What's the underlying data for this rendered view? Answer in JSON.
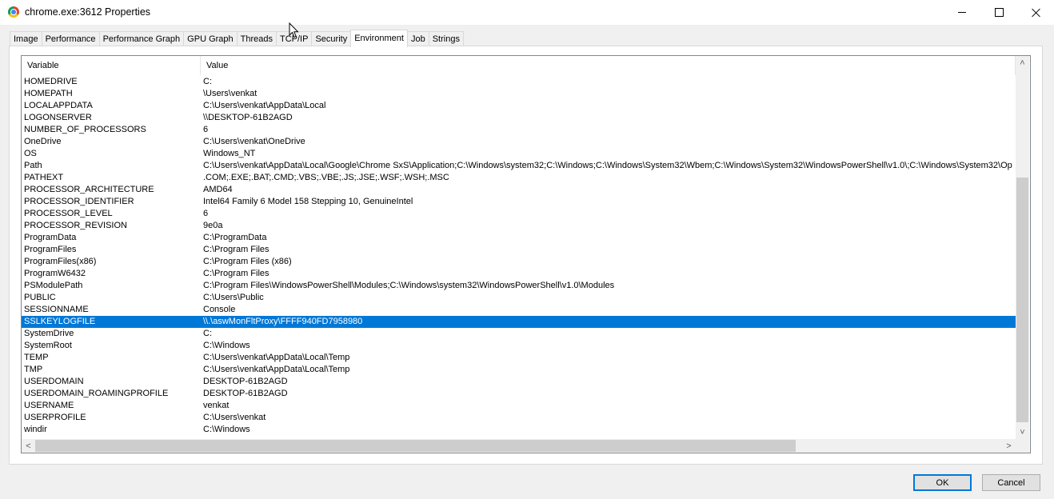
{
  "window": {
    "title": "chrome.exe:3612 Properties",
    "app_icon": "chrome-icon"
  },
  "tabs": [
    "Image",
    "Performance",
    "Performance Graph",
    "GPU Graph",
    "Threads",
    "TCP/IP",
    "Security",
    "Environment",
    "Job",
    "Strings"
  ],
  "active_tab": "Environment",
  "list": {
    "columns": [
      "Variable",
      "Value"
    ],
    "selected_row": "SSLKEYLOGFILE",
    "rows": [
      {
        "variable": "HOMEDRIVE",
        "value": "C:"
      },
      {
        "variable": "HOMEPATH",
        "value": "\\Users\\venkat"
      },
      {
        "variable": "LOCALAPPDATA",
        "value": "C:\\Users\\venkat\\AppData\\Local"
      },
      {
        "variable": "LOGONSERVER",
        "value": "\\\\DESKTOP-61B2AGD"
      },
      {
        "variable": "NUMBER_OF_PROCESSORS",
        "value": "6"
      },
      {
        "variable": "OneDrive",
        "value": "C:\\Users\\venkat\\OneDrive"
      },
      {
        "variable": "OS",
        "value": "Windows_NT"
      },
      {
        "variable": "Path",
        "value": "C:\\Users\\venkat\\AppData\\Local\\Google\\Chrome SxS\\Application;C:\\Windows\\system32;C:\\Windows;C:\\Windows\\System32\\Wbem;C:\\Windows\\System32\\WindowsPowerShell\\v1.0\\;C:\\Windows\\System32\\Op"
      },
      {
        "variable": "PATHEXT",
        "value": ".COM;.EXE;.BAT;.CMD;.VBS;.VBE;.JS;.JSE;.WSF;.WSH;.MSC"
      },
      {
        "variable": "PROCESSOR_ARCHITECTURE",
        "value": "AMD64"
      },
      {
        "variable": "PROCESSOR_IDENTIFIER",
        "value": "Intel64 Family 6 Model 158 Stepping 10, GenuineIntel"
      },
      {
        "variable": "PROCESSOR_LEVEL",
        "value": "6"
      },
      {
        "variable": "PROCESSOR_REVISION",
        "value": "9e0a"
      },
      {
        "variable": "ProgramData",
        "value": "C:\\ProgramData"
      },
      {
        "variable": "ProgramFiles",
        "value": "C:\\Program Files"
      },
      {
        "variable": "ProgramFiles(x86)",
        "value": "C:\\Program Files (x86)"
      },
      {
        "variable": "ProgramW6432",
        "value": "C:\\Program Files"
      },
      {
        "variable": "PSModulePath",
        "value": "C:\\Program Files\\WindowsPowerShell\\Modules;C:\\Windows\\system32\\WindowsPowerShell\\v1.0\\Modules"
      },
      {
        "variable": "PUBLIC",
        "value": "C:\\Users\\Public"
      },
      {
        "variable": "SESSIONNAME",
        "value": "Console"
      },
      {
        "variable": "SSLKEYLOGFILE",
        "value": "\\\\.\\aswMonFltProxy\\FFFF940FD7958980"
      },
      {
        "variable": "SystemDrive",
        "value": "C:"
      },
      {
        "variable": "SystemRoot",
        "value": "C:\\Windows"
      },
      {
        "variable": "TEMP",
        "value": "C:\\Users\\venkat\\AppData\\Local\\Temp"
      },
      {
        "variable": "TMP",
        "value": "C:\\Users\\venkat\\AppData\\Local\\Temp"
      },
      {
        "variable": "USERDOMAIN",
        "value": "DESKTOP-61B2AGD"
      },
      {
        "variable": "USERDOMAIN_ROAMINGPROFILE",
        "value": "DESKTOP-61B2AGD"
      },
      {
        "variable": "USERNAME",
        "value": "venkat"
      },
      {
        "variable": "USERPROFILE",
        "value": "C:\\Users\\venkat"
      },
      {
        "variable": "windir",
        "value": "C:\\Windows"
      }
    ]
  },
  "buttons": {
    "ok": "OK",
    "cancel": "Cancel"
  },
  "colors": {
    "selection": "#0078d7",
    "default_button_border": "#0078d7"
  }
}
